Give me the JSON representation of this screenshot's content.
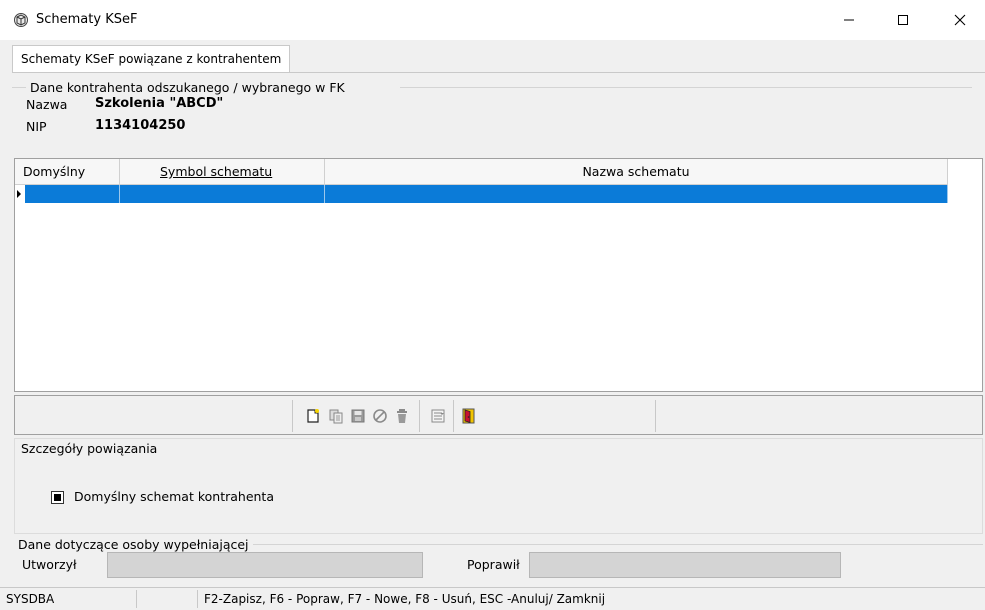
{
  "window": {
    "title": "Schematy KSeF",
    "icon": "schema-app-icon",
    "controls": {
      "minimize": "minimize-icon",
      "maximize": "maximize-icon",
      "close": "close-icon"
    }
  },
  "tabs": [
    {
      "label": "Schematy KSeF powiązane z kontrahentem",
      "active": true
    }
  ],
  "contractor": {
    "group_title": "Dane kontrahenta odszukanego / wybranego w FK",
    "name_label": "Nazwa",
    "name_value": "Szkolenia \"ABCD\"",
    "nip_label": "NIP",
    "nip_value": "1134104250"
  },
  "grid": {
    "columns": [
      "Domyślny",
      "Symbol schematu",
      "Nazwa schematu"
    ],
    "rows": [
      {
        "default": "",
        "symbol": "",
        "name": "",
        "selected": true
      }
    ],
    "selection_color": "#0b7bd8"
  },
  "toolbar": {
    "buttons": [
      "new-icon",
      "copy-icon",
      "save-icon",
      "cancel-icon",
      "delete-icon",
      "details-icon",
      "exit-icon"
    ]
  },
  "details": {
    "group_title": "Szczegóły powiązania",
    "checkbox_label": "Domyślny schemat kontrahenta",
    "checkbox_state": "indeterminate"
  },
  "person": {
    "group_title": "Dane dotyczące osoby wypełniającej",
    "created_label": "Utworzył",
    "created_value": "",
    "modified_label": "Poprawił",
    "modified_value": ""
  },
  "statusbar": {
    "user": "SYSDBA",
    "middle": "",
    "hints": "F2-Zapisz,  F6 - Popraw, F7 - Nowe, F8 - Usuń, ESC -Anuluj/ Zamknij"
  }
}
